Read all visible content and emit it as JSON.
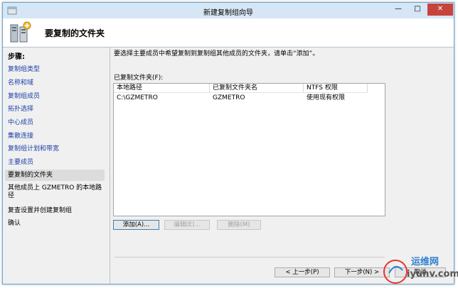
{
  "window": {
    "title": "新建复制组向导",
    "min_glyph": "—",
    "max_glyph": "□",
    "close_glyph": "✕"
  },
  "header": {
    "title": "要复制的文件夹"
  },
  "sidebar": {
    "label": "步骤:",
    "steps": [
      {
        "label": "复制组类型",
        "state": "link"
      },
      {
        "label": "名称和域",
        "state": "link"
      },
      {
        "label": "复制组成员",
        "state": "link"
      },
      {
        "label": "拓扑选择",
        "state": "link"
      },
      {
        "label": "中心成员",
        "state": "link"
      },
      {
        "label": "集散连接",
        "state": "link"
      },
      {
        "label": "复制组计划和带宽",
        "state": "link"
      },
      {
        "label": "主要成员",
        "state": "link"
      },
      {
        "label": "要复制的文件夹",
        "state": "current"
      },
      {
        "label": "其他成员上 GZMETRO 的本地路径",
        "state": "plain"
      },
      {
        "label": "复查设置并创建复制组",
        "state": "plain"
      },
      {
        "label": "确认",
        "state": "plain"
      }
    ]
  },
  "main": {
    "instruction": "要选择主要成员中希望复制到复制组其他成员的文件夹，请单击“添加”。",
    "list_label": "已复制文件夹(F):",
    "columns": [
      "本地路径",
      "已复制文件夹名",
      "NTFS 权限"
    ],
    "rows": [
      [
        "C:\\GZMETRO",
        "GZMETRO",
        "使用现有权限"
      ]
    ],
    "add_button": "添加(A)...",
    "edit_button": "编辑(E)...",
    "delete_button": "删除(M)"
  },
  "footer": {
    "back_button": "< 上一步(P)",
    "next_button": "下一步(N) >",
    "cancel_button": "取消"
  },
  "watermark": {
    "text": "运维网",
    "url": "iyunv.com"
  },
  "colors": {
    "titlebar": "#d6e6f4",
    "link": "#1c3fa8",
    "close": "#c7443d"
  }
}
